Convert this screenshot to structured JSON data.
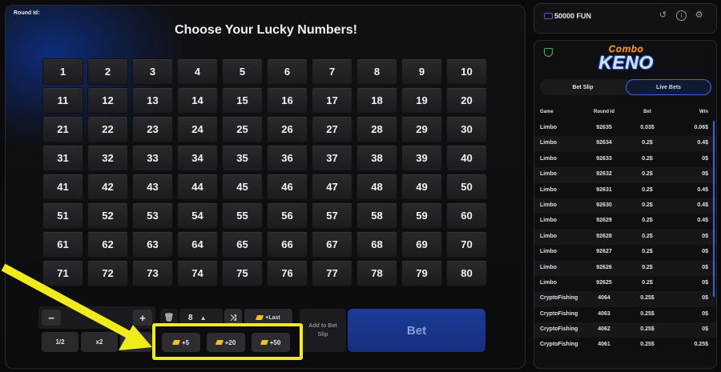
{
  "game": {
    "round_label": "Round Id:",
    "title": "Choose Your Lucky Numbers!",
    "numbers": [
      "1",
      "2",
      "3",
      "4",
      "5",
      "6",
      "7",
      "8",
      "9",
      "10",
      "11",
      "12",
      "13",
      "14",
      "15",
      "16",
      "17",
      "18",
      "19",
      "20",
      "21",
      "22",
      "23",
      "24",
      "25",
      "26",
      "27",
      "28",
      "29",
      "30",
      "31",
      "32",
      "33",
      "34",
      "35",
      "36",
      "37",
      "38",
      "39",
      "40",
      "41",
      "42",
      "43",
      "44",
      "45",
      "46",
      "47",
      "48",
      "49",
      "50",
      "51",
      "52",
      "53",
      "54",
      "55",
      "56",
      "57",
      "58",
      "59",
      "60",
      "61",
      "62",
      "63",
      "64",
      "65",
      "66",
      "67",
      "68",
      "69",
      "70",
      "71",
      "72",
      "73",
      "74",
      "75",
      "76",
      "77",
      "78",
      "79",
      "80"
    ]
  },
  "controls": {
    "minus": "−",
    "plus": "+",
    "half": "1/2",
    "double": "x2",
    "pick_count": "8",
    "last_label": "+Last",
    "add_to_slip": "Add to Bet Slip",
    "bet": "Bet",
    "quick_add": [
      "+5",
      "+20",
      "+50"
    ]
  },
  "header": {
    "balance": "50000 FUN",
    "icons": [
      "history-icon",
      "info-icon",
      "settings-icon"
    ]
  },
  "sidebar": {
    "logo_top": "Combo",
    "logo_bottom": "KENO",
    "tabs": [
      "Bet Slip",
      "Live Bets"
    ],
    "active_tab": "Live Bets",
    "columns": [
      "Game",
      "Round Id",
      "Bet",
      "Win"
    ],
    "bets": [
      {
        "game": "Limbo",
        "round": "92635",
        "bet": "0.03$",
        "win": "0.06$"
      },
      {
        "game": "Limbo",
        "round": "92634",
        "bet": "0.2$",
        "win": "0.4$"
      },
      {
        "game": "Limbo",
        "round": "92633",
        "bet": "0.2$",
        "win": "0$"
      },
      {
        "game": "Limbo",
        "round": "92632",
        "bet": "0.2$",
        "win": "0$"
      },
      {
        "game": "Limbo",
        "round": "92631",
        "bet": "0.2$",
        "win": "0.4$"
      },
      {
        "game": "Limbo",
        "round": "92630",
        "bet": "0.2$",
        "win": "0.4$"
      },
      {
        "game": "Limbo",
        "round": "92629",
        "bet": "0.2$",
        "win": "0.4$"
      },
      {
        "game": "Limbo",
        "round": "92628",
        "bet": "0.2$",
        "win": "0$"
      },
      {
        "game": "Limbo",
        "round": "92627",
        "bet": "0.2$",
        "win": "0$"
      },
      {
        "game": "Limbo",
        "round": "92626",
        "bet": "0.2$",
        "win": "0$"
      },
      {
        "game": "Limbo",
        "round": "92625",
        "bet": "0.2$",
        "win": "0$"
      },
      {
        "game": "CryptoFishing",
        "round": "4064",
        "bet": "0.25$",
        "win": "0$"
      },
      {
        "game": "CryptoFishing",
        "round": "4063",
        "bet": "0.25$",
        "win": "0$"
      },
      {
        "game": "CryptoFishing",
        "round": "4062",
        "bet": "0.25$",
        "win": "0$"
      },
      {
        "game": "CryptoFishing",
        "round": "4061",
        "bet": "0.25$",
        "win": "0.25$"
      }
    ]
  },
  "annotation": {
    "highlight_color": "#f0ec1c"
  }
}
